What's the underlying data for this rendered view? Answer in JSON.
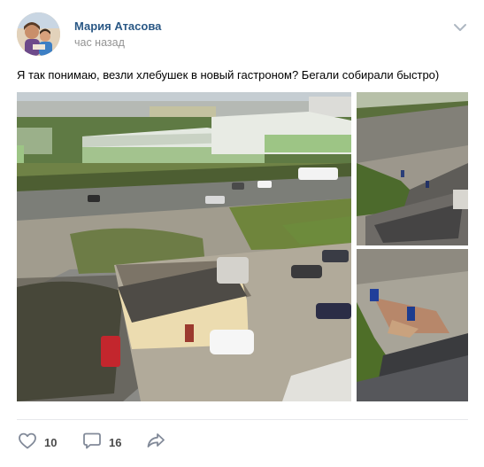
{
  "post": {
    "author": "Мария Атасова",
    "time": "час назад",
    "text": "Я так понимаю, везли хлебушек в новый гастроном? Бегали собирали быстро)",
    "photos": [
      {
        "name": "yard-overview-photo"
      },
      {
        "name": "road-closeup-photo"
      },
      {
        "name": "people-collecting-photo"
      }
    ]
  },
  "actions": {
    "likes": "10",
    "comments": "16"
  },
  "icons": [
    "avatar",
    "more-chevron-icon",
    "like-heart-icon",
    "comment-icon",
    "share-icon"
  ],
  "colors": {
    "author_link": "#2a5885",
    "muted": "#939393",
    "icon": "#828a99"
  }
}
